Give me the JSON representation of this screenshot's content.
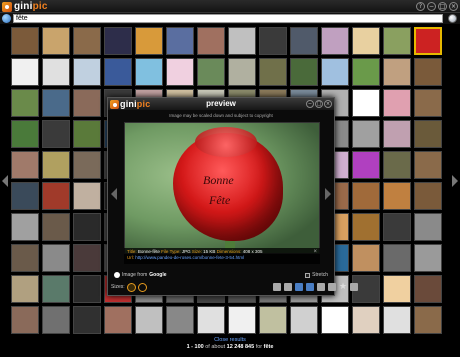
{
  "app": {
    "logo_text_a": "gini",
    "logo_text_b": "pic"
  },
  "search": {
    "value": "fête"
  },
  "window_buttons": [
    "?",
    "−",
    "□",
    "×"
  ],
  "thumbnail_colors": [
    "#7b5a3a",
    "#c9a46c",
    "#8a6a4a",
    "#2d2d4a",
    "#d89a3a",
    "#5a6ea0",
    "#a07060",
    "#c0c0c0",
    "#3a3a3a",
    "#505a6a",
    "#c0a0c0",
    "#e8d0a0",
    "#8aa060",
    "#cc2222",
    "#f0f0f0",
    "#e0e0e0",
    "#c0d0e0",
    "#3a5a9a",
    "#80c0e0",
    "#f0d0e0",
    "#6a8a5a",
    "#b0b0a0",
    "#70704a",
    "#4a6a3a",
    "#a0c0e0",
    "#6a9a4a",
    "#c0a080",
    "#7a5a3a",
    "#6a8a4a",
    "#4a6a8a",
    "#8a6a5a",
    "#3a3a3a",
    "#c0a0a0",
    "#d0c0a0",
    "#c8c8b8",
    "#8a8a6a",
    "#8a7a5a",
    "#7a8a9a",
    "#b0b0b0",
    "#ffffff",
    "#e0a0b0",
    "#8a6a4a",
    "#4a7a3a",
    "#3a3a3a",
    "#5a7a3a",
    "#2a4a6a",
    "#a03020",
    "#c04040",
    "#6a5a4a",
    "#3a3a3a",
    "#5a4a3a",
    "#2a2a2a",
    "#8a8a8a",
    "#a0a0a0",
    "#c0a0b0",
    "#6a5a3a",
    "#a07a6a",
    "#b0a060",
    "#7a6a5a",
    "#4a4a4a",
    "#e0e0e0",
    "#a0a0a0",
    "#5a5a5a",
    "#3a3a3a",
    "#6a4a3a",
    "#8a8a8a",
    "#d0b0d0",
    "#b040c0",
    "#6a6a4a",
    "#8a6a4a",
    "#3a4a5a",
    "#a03a2a",
    "#c0b0a0",
    "#2a2a2a",
    "#5a5a5a",
    "#8a7a6a",
    "#4a4a4a",
    "#6a6a6a",
    "#3a3a3a",
    "#7a7a7a",
    "#9a6a4a",
    "#a06a3a",
    "#c08040",
    "#7a5a3a",
    "#a0a0a0",
    "#6a5a4a",
    "#2a2a2a",
    "#4a4a4a",
    "#d0d0d0",
    "#aaaaaa",
    "#666666",
    "#333333",
    "#777777",
    "#999999",
    "#d8a060",
    "#a07030",
    "#3a3a3a",
    "#8a8a8a",
    "#6a5a4a",
    "#8a8a8a",
    "#4a3a3a",
    "#5a5a5a",
    "#aaaaaa",
    "#777777",
    "#555555",
    "#444444",
    "#666666",
    "#888888",
    "#2a6a9a",
    "#c09060",
    "#6a6a6a",
    "#9a9a9a",
    "#b0a080",
    "#5a7a6a",
    "#2a2a2a",
    "#c03030",
    "#8a8a8a",
    "#666666",
    "#444444",
    "#555555",
    "#777777",
    "#999999",
    "#c0c0c0",
    "#3a3a3a",
    "#f0d0a0",
    "#6a4a3a",
    "#8a6a5a",
    "#707070",
    "#303030",
    "#a07060",
    "#c0c0c0",
    "#888888",
    "#e0e0e0",
    "#f0f0f0",
    "#c0c0a0",
    "#d0d0d0",
    "#ffffff",
    "#e0d0c0",
    "#e0e0e0",
    "#8a6a4a"
  ],
  "selected_thumb_index": 13,
  "preview": {
    "title": "preview",
    "note": "Image may be scaled down and subject to copyright",
    "image_text_1": "Bonne",
    "image_text_2": "Fête",
    "info": {
      "title_label": "Title:",
      "title_value": "Bonne-fête",
      "filetype_label": "File Type:",
      "filetype_value": "JPG",
      "size_label": "Size:",
      "size_value": "15 KB",
      "dims_label": "Dimensions:",
      "dims_value": "408 x 305",
      "url_label": "Url:",
      "url_value": "http://www.pandeo-de-roses.com/bonne-fete-3-54.html"
    },
    "source_prefix": "Image from",
    "source_name": "Google",
    "stretch_label": "Stretch"
  },
  "toolbar": {
    "sizes_label": "Sizes:"
  },
  "footer": {
    "close_label": "Close results",
    "range": "1 - 100",
    "of_about": "of about",
    "total": "12 248 845",
    "for": "for",
    "query": "fête"
  },
  "colors": {
    "accent": "#e69b1e",
    "link": "#6aa5ff",
    "selected_border": "#e6b800"
  }
}
